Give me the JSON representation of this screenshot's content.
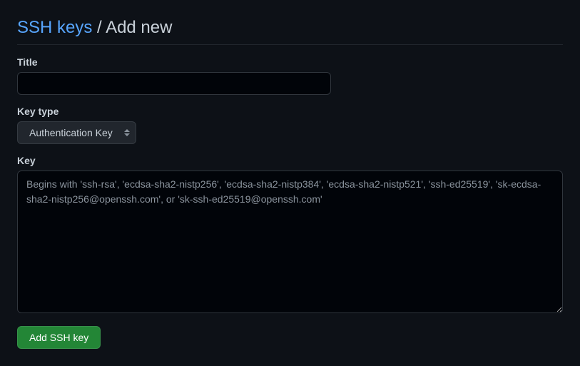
{
  "header": {
    "breadcrumb_link": "SSH keys",
    "breadcrumb_separator": " / ",
    "breadcrumb_current": "Add new"
  },
  "form": {
    "title": {
      "label": "Title",
      "value": ""
    },
    "key_type": {
      "label": "Key type",
      "selected": "Authentication Key"
    },
    "key": {
      "label": "Key",
      "value": "",
      "placeholder": "Begins with 'ssh-rsa', 'ecdsa-sha2-nistp256', 'ecdsa-sha2-nistp384', 'ecdsa-sha2-nistp521', 'ssh-ed25519', 'sk-ecdsa-sha2-nistp256@openssh.com', or 'sk-ssh-ed25519@openssh.com'"
    },
    "submit_label": "Add SSH key"
  }
}
